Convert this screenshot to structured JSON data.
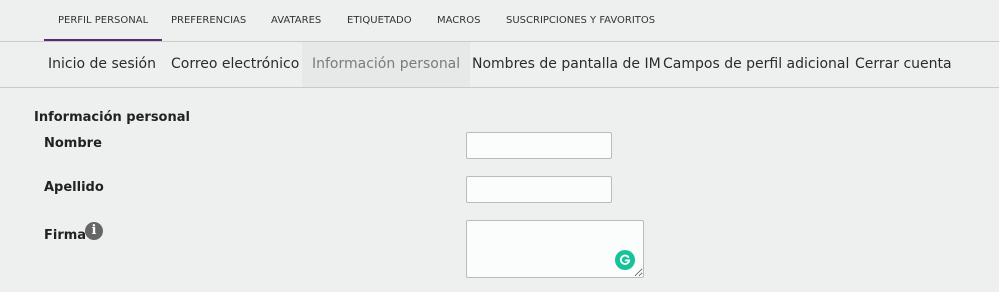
{
  "top_tabs": [
    {
      "label": "PERFIL PERSONAL",
      "active": true
    },
    {
      "label": "PREFERENCIAS",
      "active": false
    },
    {
      "label": "AVATARES",
      "active": false
    },
    {
      "label": "ETIQUETADO",
      "active": false
    },
    {
      "label": "MACROS",
      "active": false
    },
    {
      "label": "SUSCRIPCIONES Y FAVORITOS",
      "active": false
    }
  ],
  "sub_tabs": [
    {
      "label": "Inicio de sesión",
      "active": false
    },
    {
      "label": "Correo electrónico",
      "active": false
    },
    {
      "label": "Información personal",
      "active": true
    },
    {
      "label": "Nombres de pantalla de IM",
      "active": false
    },
    {
      "label": "Campos de perfil adicional",
      "active": false
    },
    {
      "label": "Cerrar cuenta",
      "active": false
    }
  ],
  "form": {
    "section_title": "Información personal",
    "nombre": {
      "label": "Nombre",
      "value": ""
    },
    "apellido": {
      "label": "Apellido",
      "value": ""
    },
    "firma": {
      "label": "Firma",
      "value": "",
      "info_icon": "info-icon",
      "extension_icon": "grammarly-icon"
    }
  },
  "colors": {
    "active_tab_underline": "#5b2a6e",
    "grammarly": "#15c39a",
    "background": "#eef0ef"
  }
}
